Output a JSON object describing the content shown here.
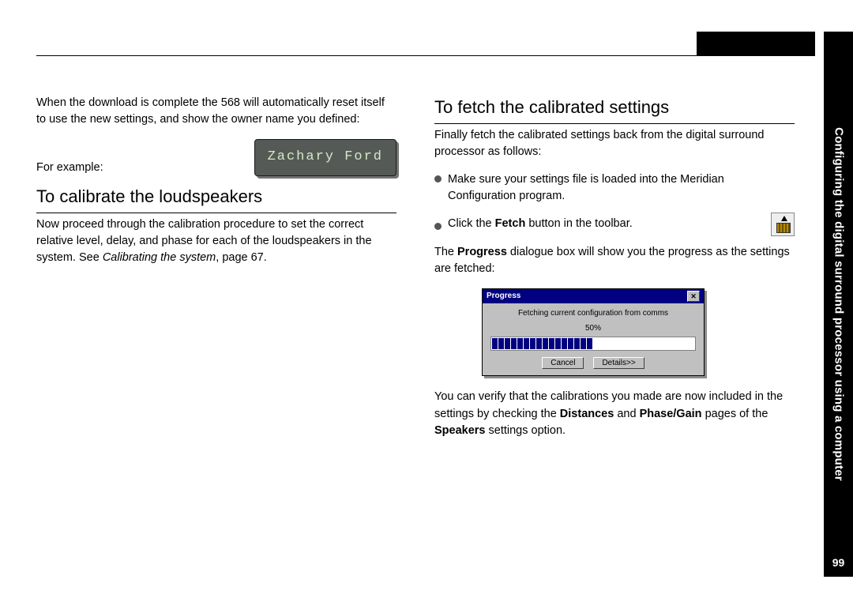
{
  "sidebar": {
    "chapter_title": "Configuring the digital surround processor using a computer",
    "page_number": "99"
  },
  "left": {
    "intro_para": "When the download is complete the 568 will automatically reset itself to use the new settings, and show the owner name you defined:",
    "for_example": "For example:",
    "lcd_text": "Zachary Ford",
    "section_title": "To calibrate the loudspeakers",
    "calib_para_a": "Now proceed through the calibration procedure to set the correct relative level, delay, and phase for each of the loudspeakers in the system. See ",
    "calib_para_italic": "Calibrating the system",
    "calib_para_b": ", page 67."
  },
  "right": {
    "section_title": "To fetch the calibrated settings",
    "intro_para": "Finally fetch the calibrated settings back from the digital surround processor as follows:",
    "bullet1": "Make sure your settings file is loaded into the Meridian Configuration program.",
    "bullet2_a": "Click the ",
    "bullet2_bold": "Fetch",
    "bullet2_b": " button in the toolbar.",
    "progress_para_a": "The ",
    "progress_para_bold": "Progress",
    "progress_para_b": " dialogue box will show you the progress as the settings are fetched:",
    "dialog": {
      "title": "Progress",
      "message": "Fetching current configuration from comms",
      "percent": "50%",
      "fill_width": "50%",
      "btn_cancel": "Cancel",
      "btn_details": "Details>>"
    },
    "verify_a": "You can verify that the calibrations you made are now included in the settings by checking the ",
    "verify_bold1": "Distances",
    "verify_mid": " and ",
    "verify_bold2": "Phase/Gain",
    "verify_b": " pages of the ",
    "verify_bold3": "Speakers",
    "verify_c": " settings option."
  }
}
